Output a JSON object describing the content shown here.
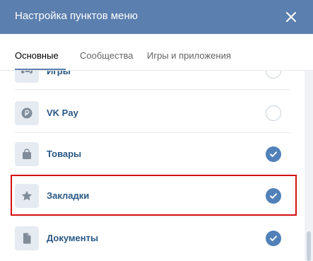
{
  "dialog": {
    "title": "Настройка пунктов меню",
    "close_icon": "close-icon"
  },
  "tabs": [
    {
      "label": "Основные",
      "active": true
    },
    {
      "label": "Сообщества",
      "active": false
    },
    {
      "label": "Игры и приложения",
      "active": false
    }
  ],
  "menu_items": [
    {
      "label": "Игры",
      "icon": "gamepad-icon",
      "checked": false
    },
    {
      "label": "VK Pay",
      "icon": "ruble-coin-icon",
      "checked": false
    },
    {
      "label": "Товары",
      "icon": "shopping-bag-icon",
      "checked": true
    },
    {
      "label": "Закладки",
      "icon": "star-icon",
      "checked": true,
      "highlighted": true
    },
    {
      "label": "Документы",
      "icon": "document-icon",
      "checked": true
    }
  ],
  "colors": {
    "header": "#5b7fae",
    "label": "#2a5885",
    "check_on": "#5181b8",
    "highlight": "#d60f0f"
  }
}
